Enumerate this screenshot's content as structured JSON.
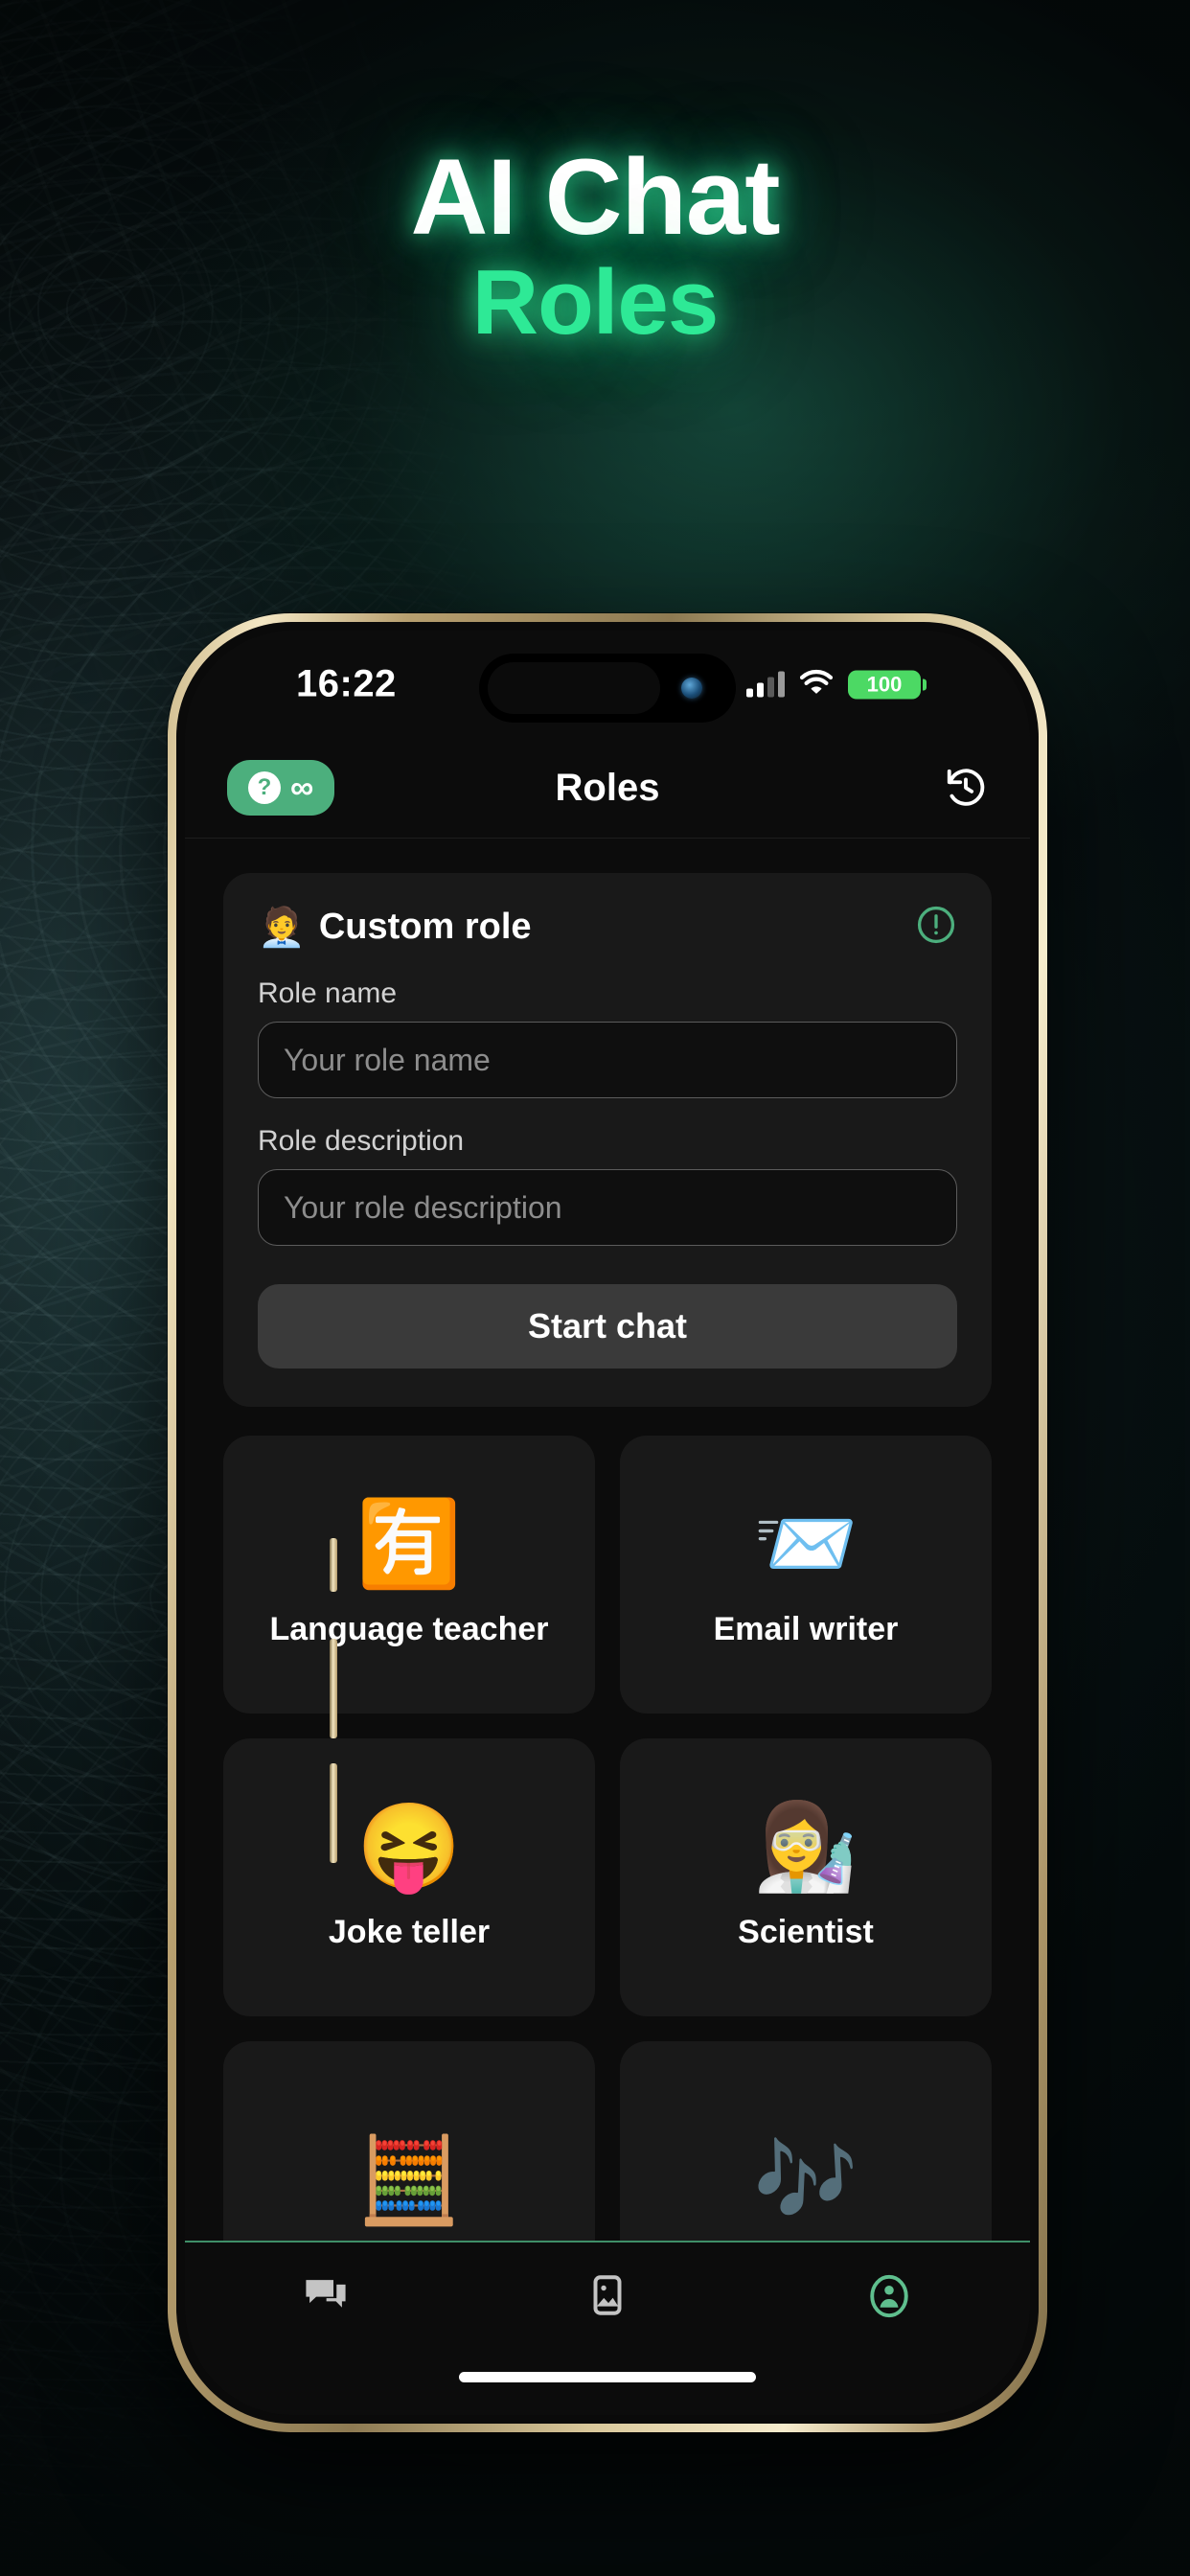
{
  "poster": {
    "headline_line1": "AI Chat",
    "headline_line2": "Roles",
    "accent_color": "#2ee996",
    "background_color": "#0d1a18"
  },
  "status_bar": {
    "time": "16:22",
    "battery_percent": "100",
    "battery_color": "#4cd964",
    "signal_icon": "cellular-signal-icon",
    "wifi_icon": "wifi-icon"
  },
  "app_bar": {
    "title": "Roles",
    "help_badge": {
      "question_mark": "?",
      "infinity": "∞",
      "color": "#4caf7d"
    },
    "history_icon": "history-icon"
  },
  "custom_role": {
    "emoji": "🧑‍💼",
    "title": "Custom role",
    "info_icon": "info-exclamation-icon",
    "info_color": "#4caf7d",
    "name_label": "Role name",
    "name_placeholder": "Your role name",
    "name_value": "",
    "description_label": "Role description",
    "description_placeholder": "Your role description",
    "description_value": "",
    "start_button": "Start chat"
  },
  "roles": [
    {
      "emoji": "🈶",
      "label": "Language teacher",
      "icon": "japanese-has-button-icon"
    },
    {
      "emoji": "📨",
      "label": "Email writer",
      "icon": "incoming-envelope-icon"
    },
    {
      "emoji": "😝",
      "label": "Joke teller",
      "icon": "squinting-tongue-face-icon"
    },
    {
      "emoji": "👩‍🔬",
      "label": "Scientist",
      "icon": "woman-scientist-icon"
    },
    {
      "emoji": "🧮",
      "label": "",
      "icon": "abacus-calculator-icon"
    },
    {
      "emoji": "🎶",
      "label": "",
      "icon": "musical-notes-icon"
    }
  ],
  "tab_bar": {
    "items": [
      {
        "icon": "chat-bubbles-icon",
        "active": false
      },
      {
        "icon": "image-icon",
        "active": false
      },
      {
        "icon": "profile-icon",
        "active": true
      }
    ],
    "active_color": "#5fbf8e",
    "inactive_color": "#c4c4c4"
  }
}
